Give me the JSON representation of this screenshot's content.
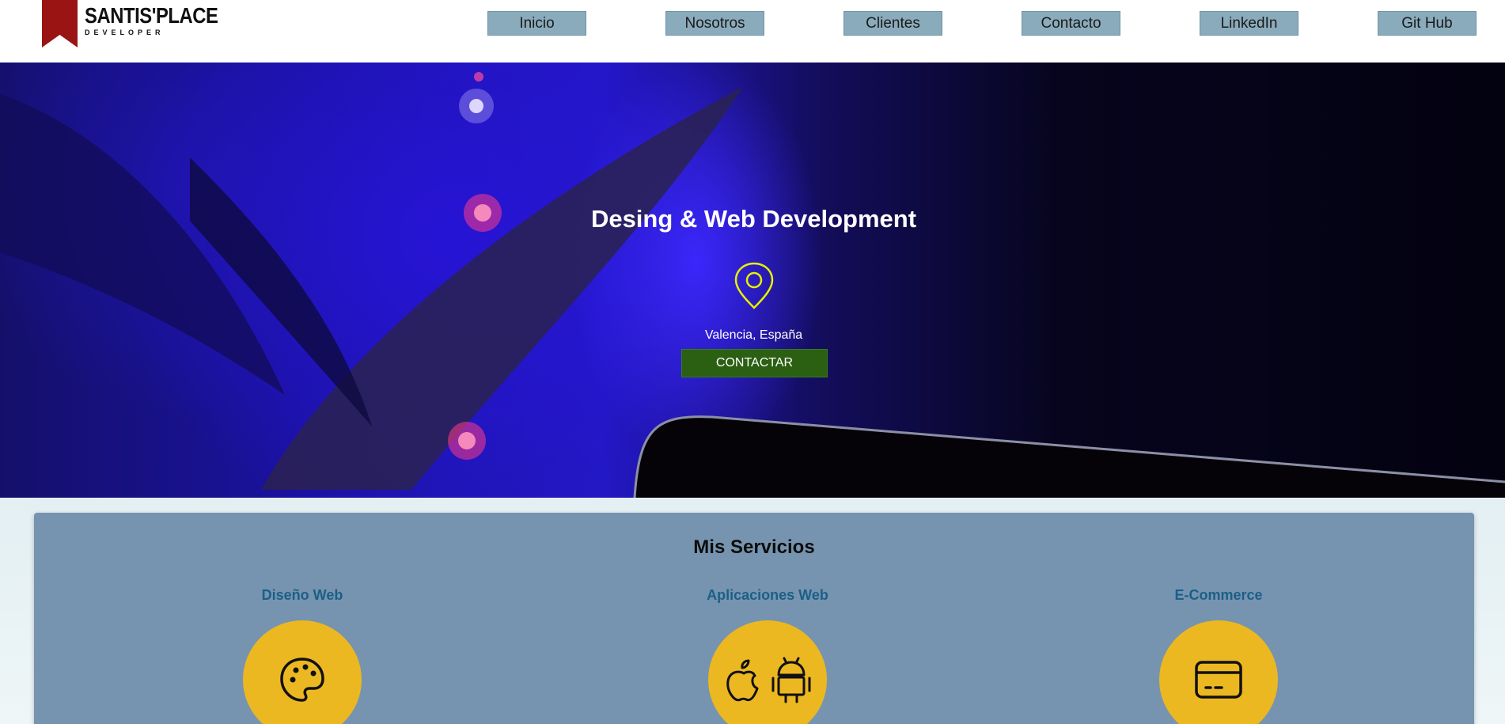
{
  "header": {
    "brand": "SANTIS'PLACE",
    "brand_sub": "DEVELOPER",
    "nav": [
      "Inicio",
      "Nosotros",
      "Clientes",
      "Contacto",
      "LinkedIn",
      "Git Hub"
    ]
  },
  "hero": {
    "title": "Desing & Web Development",
    "location": "Valencia, España",
    "cta": "CONTACTAR"
  },
  "services": {
    "title": "Mis Servicios",
    "items": [
      {
        "title": "Diseño Web",
        "icon": "palette-icon"
      },
      {
        "title": "Aplicaciones Web",
        "icon": "apple-android-icon"
      },
      {
        "title": "E-Commerce",
        "icon": "credit-card-icon"
      }
    ]
  },
  "colors": {
    "nav_button": "#8aabbb",
    "cta": "#2b5f12",
    "services_card": "#7694b0",
    "service_circle": "#ecb821",
    "service_title": "#1c5f86",
    "pin": "#e6f000",
    "logo_ribbon": "#9b1414"
  }
}
